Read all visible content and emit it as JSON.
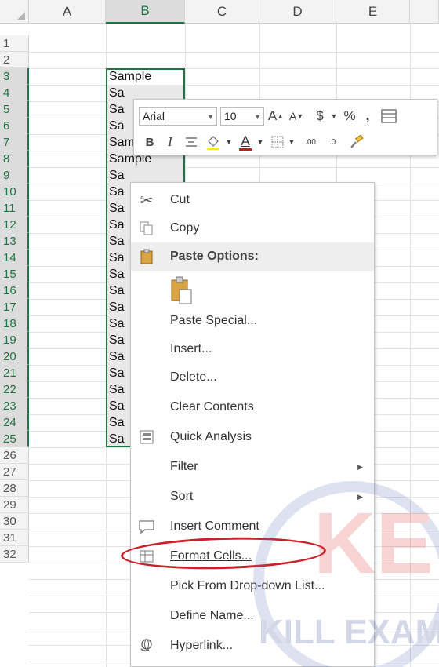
{
  "columns": [
    "A",
    "B",
    "C",
    "D",
    "E"
  ],
  "rows": [
    "1",
    "2",
    "3",
    "4",
    "5",
    "6",
    "7",
    "8",
    "9",
    "10",
    "11",
    "12",
    "13",
    "14",
    "15",
    "16",
    "17",
    "18",
    "19",
    "20",
    "21",
    "22",
    "23",
    "24",
    "25",
    "26",
    "27",
    "28",
    "29",
    "30",
    "31",
    "32"
  ],
  "cells": {
    "B3": "Sample",
    "B4": "Sa",
    "B5": "Sa",
    "B6": "Sa",
    "B7": "Sample",
    "B8": "Sample",
    "B9": "Sa",
    "B10": "Sa",
    "B11": "Sa",
    "B12": "Sa",
    "B13": "Sa",
    "B14": "Sa",
    "B15": "Sa",
    "B16": "Sa",
    "B17": "Sa",
    "B18": "Sa",
    "B19": "Sa",
    "B20": "Sa",
    "B21": "Sa",
    "B22": "Sa",
    "B23": "Sa",
    "B24": "Sa",
    "B25": "Sa"
  },
  "mini_toolbar": {
    "font_name": "Arial",
    "font_size": "10",
    "grow_font": "A",
    "shrink_font": "A",
    "currency": "$",
    "percent": "%",
    "comma": ",",
    "bold": "B",
    "italic": "I",
    "font_color_letter": "A",
    "increase_decimal": ".00",
    "decrease_decimal": ".0"
  },
  "context_menu": {
    "cut": "Cut",
    "copy": "Copy",
    "paste_options": "Paste Options:",
    "paste_special": "Paste Special...",
    "insert": "Insert...",
    "delete": "Delete...",
    "clear_contents": "Clear Contents",
    "quick_analysis": "Quick Analysis",
    "filter": "Filter",
    "sort": "Sort",
    "insert_comment": "Insert Comment",
    "format_cells": "Format Cells...",
    "pick_from_dropdown": "Pick From Drop-down List...",
    "define_name": "Define Name...",
    "hyperlink": "Hyperlink..."
  },
  "watermark": {
    "logo_text": "KE",
    "banner_text": "KILL EXAM"
  },
  "colors": {
    "selection_green": "#217346",
    "highlight_red": "#c8222a"
  }
}
